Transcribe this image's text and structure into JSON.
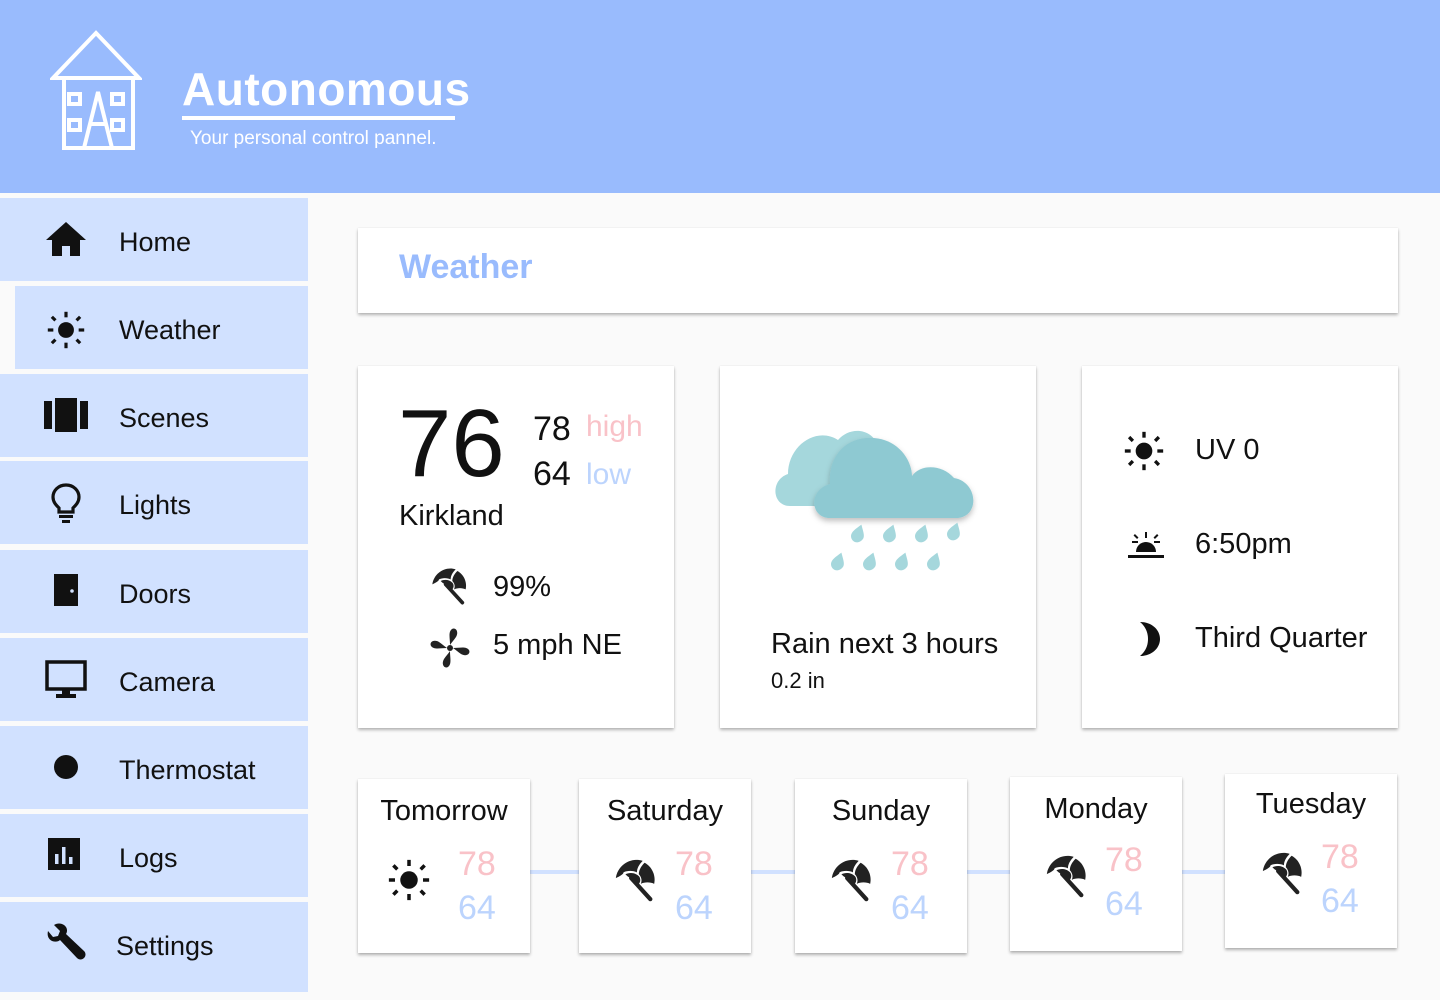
{
  "brand": {
    "title": "Autonomous",
    "subtitle": "Your personal control pannel."
  },
  "sidebar": {
    "items": [
      {
        "label": "Home",
        "icon": "home-icon"
      },
      {
        "label": "Weather",
        "icon": "sun-icon",
        "active": true
      },
      {
        "label": "Scenes",
        "icon": "scenes-icon"
      },
      {
        "label": "Lights",
        "icon": "lightbulb-icon"
      },
      {
        "label": "Doors",
        "icon": "door-icon"
      },
      {
        "label": "Camera",
        "icon": "monitor-icon"
      },
      {
        "label": "Thermostat",
        "icon": "circle-icon"
      },
      {
        "label": "Logs",
        "icon": "bar-chart-icon"
      },
      {
        "label": "Settings",
        "icon": "wrench-icon"
      }
    ]
  },
  "main": {
    "title": "Weather",
    "current": {
      "temp": "76",
      "high": "78",
      "high_label": "high",
      "low": "64",
      "low_label": "low",
      "city": "Kirkland",
      "precip": "99%",
      "wind": "5 mph NE"
    },
    "rain": {
      "title": "Rain next 3 hours",
      "amount": "0.2 in"
    },
    "details": {
      "uv": "UV 0",
      "sunset": "6:50pm",
      "moon": "Third Quarter"
    },
    "forecast": [
      {
        "day": "Tomorrow",
        "icon": "sun-icon",
        "high": "78",
        "low": "64"
      },
      {
        "day": "Saturday",
        "icon": "umbrella-icon",
        "high": "78",
        "low": "64"
      },
      {
        "day": "Sunday",
        "icon": "umbrella-icon",
        "high": "78",
        "low": "64"
      },
      {
        "day": "Monday",
        "icon": "umbrella-icon",
        "high": "78",
        "low": "64"
      },
      {
        "day": "Tuesday",
        "icon": "umbrella-icon",
        "high": "78",
        "low": "64"
      }
    ]
  },
  "colors": {
    "accent": "#99bbfd",
    "nav_bg": "#d1e1ff",
    "high": "#f9c2c8",
    "low": "#bcd4fd",
    "cloud_front": "#8ec9d2",
    "cloud_back": "#a5d7dc"
  }
}
